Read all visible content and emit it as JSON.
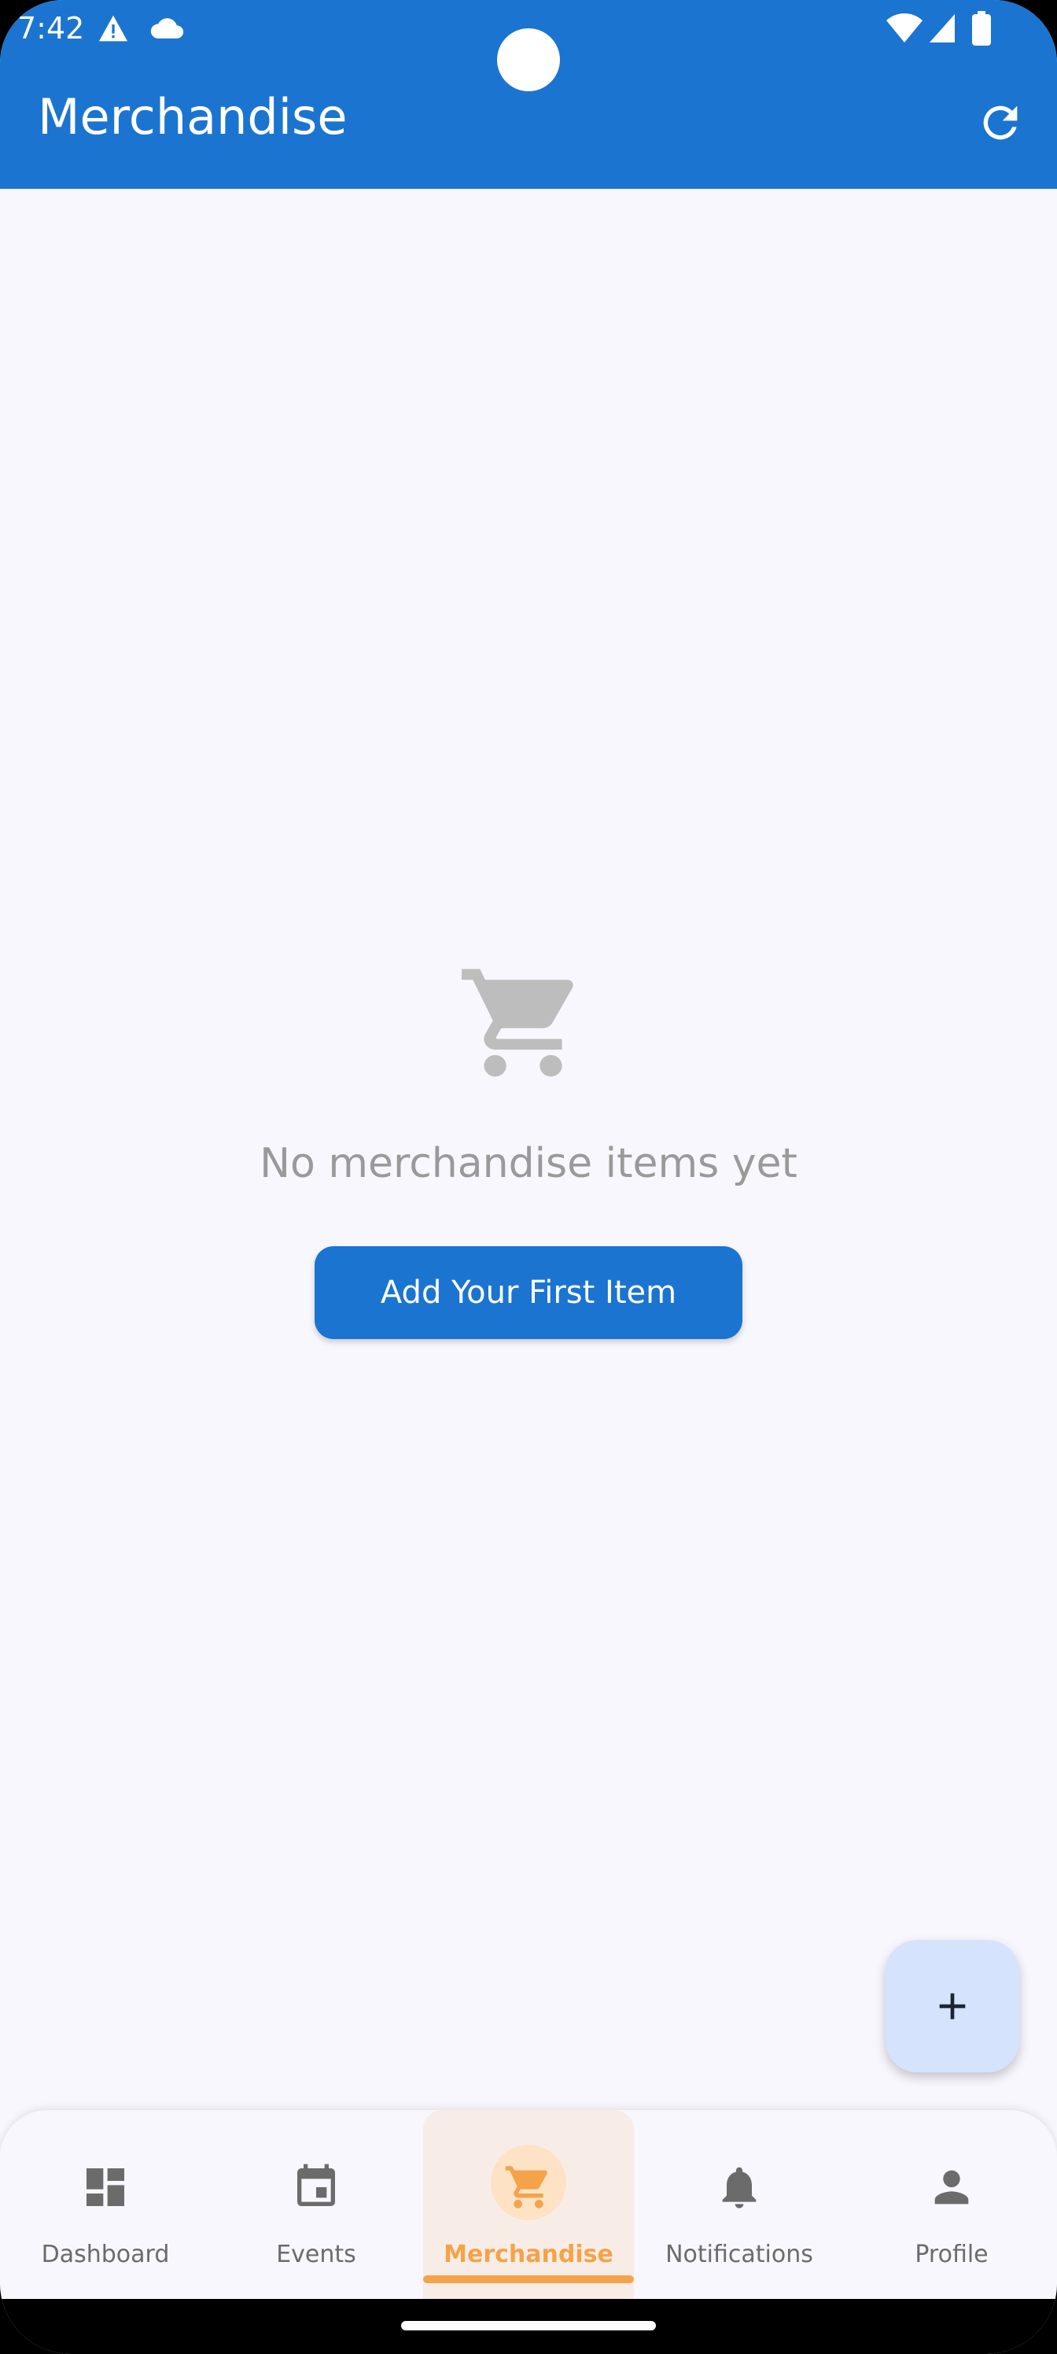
{
  "status_bar": {
    "time": "7:42",
    "icons": [
      "warning-icon",
      "cloud-icon",
      "wifi-icon",
      "signal-icon",
      "battery-icon"
    ]
  },
  "app_bar": {
    "title": "Merchandise",
    "refresh_icon": "refresh-icon"
  },
  "empty_state": {
    "icon": "shopping-cart-icon",
    "message": "No merchandise items yet",
    "button_label": "Add Your First Item"
  },
  "fab": {
    "icon": "plus-icon"
  },
  "bottom_nav": {
    "items": [
      {
        "label": "Dashboard",
        "icon": "dashboard-icon",
        "active": false
      },
      {
        "label": "Events",
        "icon": "calendar-icon",
        "active": false
      },
      {
        "label": "Merchandise",
        "icon": "shopping-cart-icon",
        "active": true
      },
      {
        "label": "Notifications",
        "icon": "bell-icon",
        "active": false
      },
      {
        "label": "Profile",
        "icon": "person-icon",
        "active": false
      }
    ]
  },
  "colors": {
    "primary": "#1b74d0",
    "background": "#f8f7fd",
    "active_accent": "#f5a34a",
    "fab_background": "#d6e3fc",
    "muted_icon": "#bdbdbd"
  }
}
